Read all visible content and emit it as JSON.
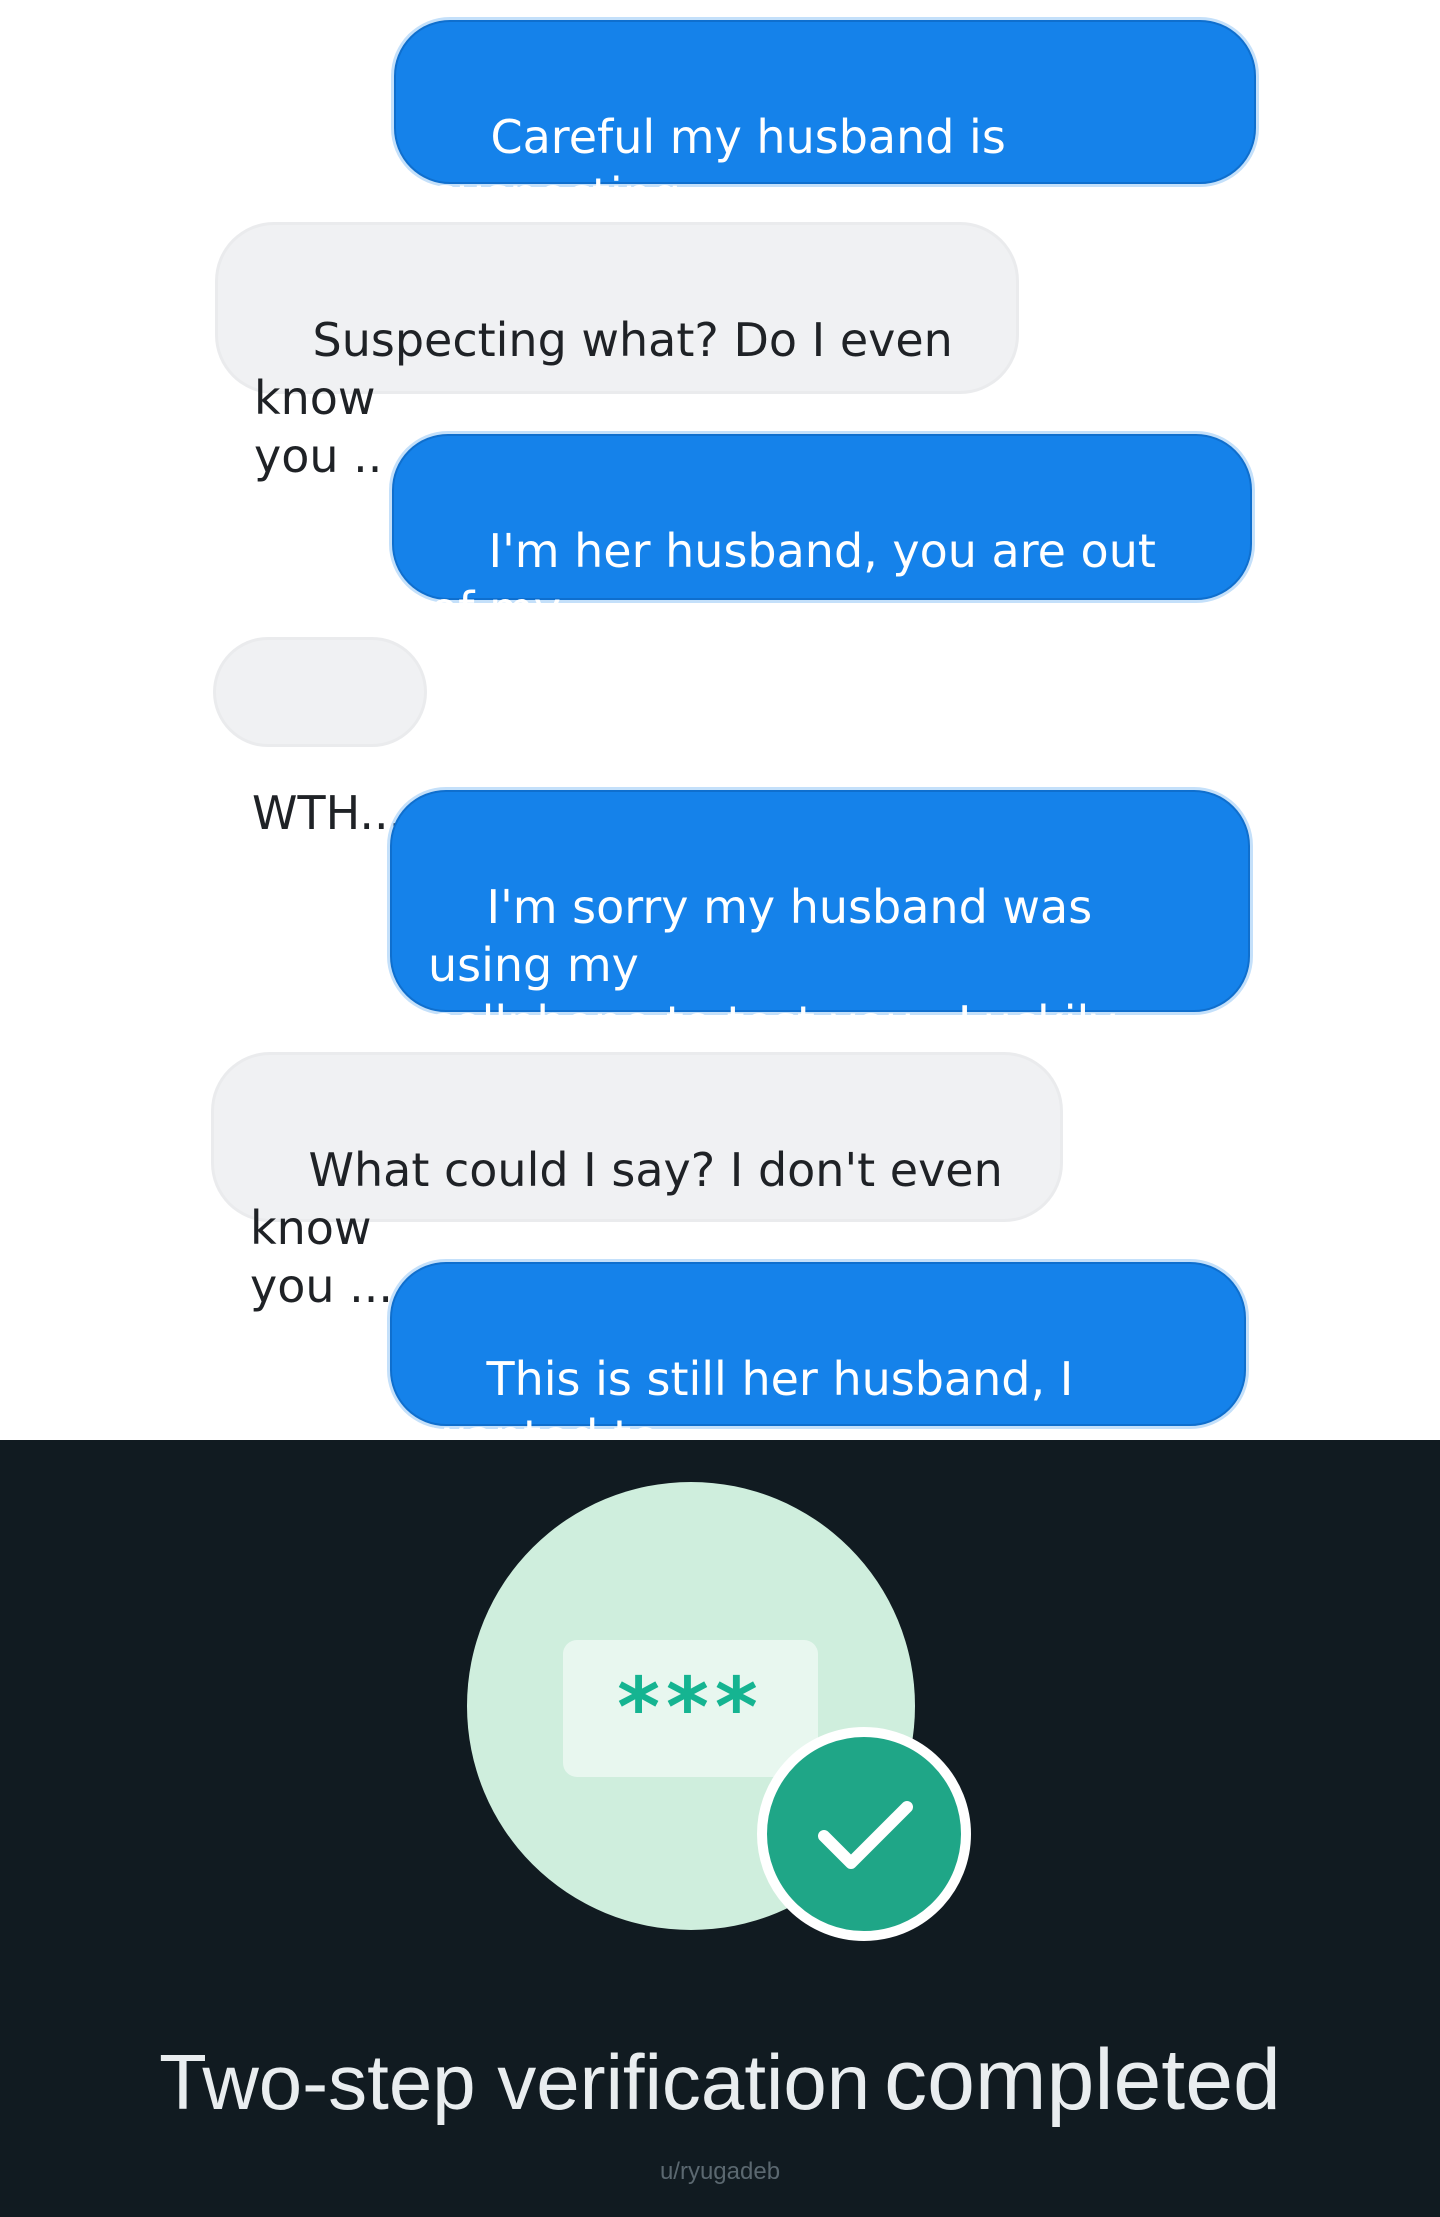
{
  "messages": [
    {
      "side": "sent",
      "text": "Careful my husband is suspecting\nus."
    },
    {
      "side": "received",
      "text": "Suspecting what? Do I even know\nyou .."
    },
    {
      "side": "sent",
      "text": "I'm her husband, you are out of my\nsuspects list."
    },
    {
      "side": "received",
      "text": "WTH..."
    },
    {
      "side": "sent",
      "text": "I'm sorry my husband was using my\ncellphone to test you,  Luckily you\nhaven't said anything",
      "emoji": "relieved-face-icon"
    },
    {
      "side": "received",
      "text": "What could I say? I don't even know\nyou ..."
    },
    {
      "side": "sent",
      "text": "This is still her husband, I wanted to\nconfirm.."
    }
  ],
  "verification": {
    "pin": "***",
    "title_part1": "Two-step verification",
    "title_part2": "completed",
    "credit": "u/ryugadeb",
    "icons": [
      "lock-pin-icon",
      "checkmark-icon"
    ],
    "colors": {
      "background": "#111b21",
      "circle": "#cfeedd",
      "accent": "#1fa687",
      "sent_bubble": "#1582ea",
      "received_bubble": "#f0f1f3"
    }
  }
}
